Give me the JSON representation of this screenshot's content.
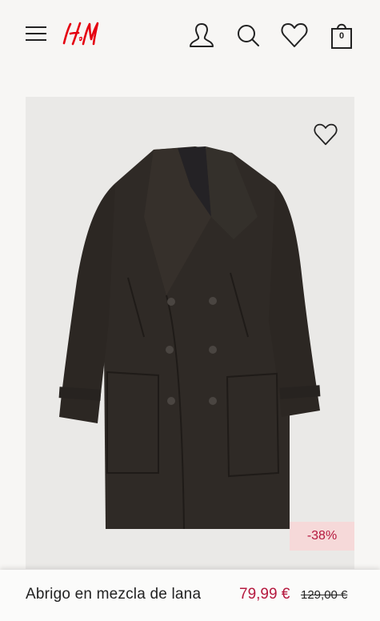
{
  "header": {
    "brand_logo": "H&M",
    "bag_count": "0",
    "icons": [
      "hamburger-menu-icon",
      "account-icon",
      "search-icon",
      "heart-icon",
      "shopping-bag-icon"
    ]
  },
  "product": {
    "name": "Abrigo en mezcla de lana",
    "sale_price": "79,99 €",
    "original_price": "129,00 €",
    "discount": "-38%",
    "image_icon": "coat-image"
  },
  "colors": {
    "brand_red": "#e50010",
    "sale_red": "#b5183e",
    "badge_bg": "#f6d9d9",
    "page_bg": "#f7f6f4",
    "image_bg": "#eae9e7"
  }
}
